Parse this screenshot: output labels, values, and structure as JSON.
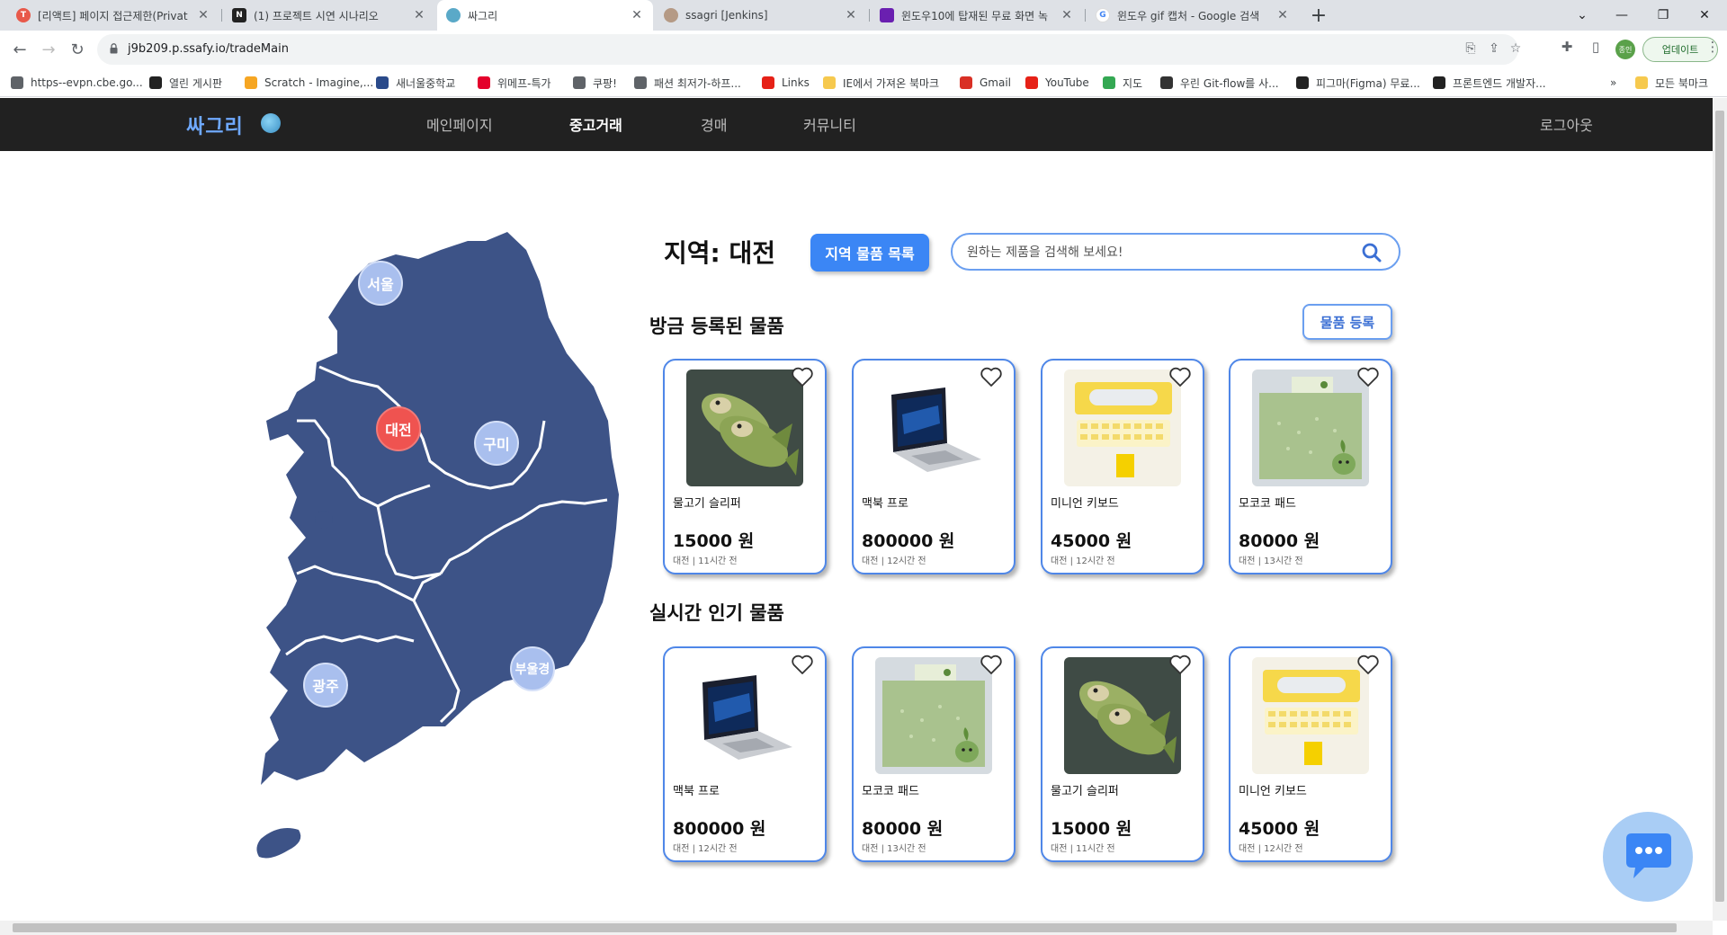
{
  "browser": {
    "tabs": [
      {
        "title": "[리액트] 페이지 접근제한(Privat",
        "favicon_color": "#e8594a",
        "favicon_text": "T"
      },
      {
        "title": "(1) 프로젝트 시연 시나리오",
        "favicon_color": "#222222",
        "favicon_text": "N"
      },
      {
        "title": "싸그리",
        "favicon_color": "#5aa9c8",
        "favicon_text": ""
      },
      {
        "title": "ssagri [Jenkins]",
        "favicon_color": "#b59a85",
        "favicon_text": ""
      },
      {
        "title": "윈도우10에 탑재된 무료 화면 녹",
        "favicon_color": "#6a1fb0",
        "favicon_text": ""
      },
      {
        "title": "윈도우 gif 캡처 - Google 검색",
        "favicon_color": "#ffffff",
        "favicon_text": "G"
      }
    ],
    "active_tab_index": 2,
    "url": "j9b209.p.ssafy.io/tradeMain",
    "profile_label": "종인",
    "update_label": "업데이트",
    "bookmarks": [
      {
        "label": "https--evpn.cbe.go...",
        "color": "#5f6368"
      },
      {
        "label": "열린 게시판",
        "color": "#222222"
      },
      {
        "label": "Scratch - Imagine,...",
        "color": "#f6a623"
      },
      {
        "label": "새너울중학교",
        "color": "#2a4a8a"
      },
      {
        "label": "위메프-특가",
        "color": "#e4002b"
      },
      {
        "label": "쿠팡!",
        "color": "#5f6368"
      },
      {
        "label": "패션 최저가-하프...",
        "color": "#5f6368"
      },
      {
        "label": "Links",
        "color": "#e62117"
      },
      {
        "label": "IE에서 가져온 북마크",
        "color": "#f6c94e"
      },
      {
        "label": "Gmail",
        "color": "#d93025"
      },
      {
        "label": "YouTube",
        "color": "#e62117"
      },
      {
        "label": "지도",
        "color": "#34a853"
      },
      {
        "label": "우린 Git-flow를 사...",
        "color": "#333333"
      },
      {
        "label": "피그마(Figma) 무료...",
        "color": "#222222"
      },
      {
        "label": "프론트엔드 개발자...",
        "color": "#222222"
      }
    ],
    "bookmarks_more": "»",
    "all_bookmarks": "모든 북마크"
  },
  "site": {
    "logo": "싸그리",
    "nav": [
      "메인페이지",
      "중고거래",
      "경매",
      "커뮤니티"
    ],
    "active_nav_index": 1,
    "logout": "로그아웃"
  },
  "map": {
    "fill_color": "#3d5387",
    "regions": [
      "서울",
      "대전",
      "구미",
      "광주",
      "부울경"
    ],
    "active_region": "대전"
  },
  "main": {
    "region_title": "지역: 대전",
    "region_list_button": "지역 물품 목록",
    "search_placeholder": "원하는 제품을 검색해 보세요!",
    "recent_title": "방금 등록된 물품",
    "register_button": "물품 등록",
    "popular_title": "실시간 인기 물품",
    "recent_items": [
      {
        "name": "물고기 슬리퍼",
        "price": "15000 원",
        "meta": "대전 | 11시간 전",
        "image": "fish"
      },
      {
        "name": "맥북 프로",
        "price": "800000 원",
        "meta": "대전 | 12시간 전",
        "image": "laptop"
      },
      {
        "name": "미니언 키보드",
        "price": "45000 원",
        "meta": "대전 | 12시간 전",
        "image": "keyboard"
      },
      {
        "name": "모코코 패드",
        "price": "80000 원",
        "meta": "대전 | 13시간 전",
        "image": "pad"
      }
    ],
    "popular_items": [
      {
        "name": "맥북 프로",
        "price": "800000 원",
        "meta": "대전 | 12시간 전",
        "image": "laptop"
      },
      {
        "name": "모코코 패드",
        "price": "80000 원",
        "meta": "대전 | 13시간 전",
        "image": "pad"
      },
      {
        "name": "물고기 슬리퍼",
        "price": "15000 원",
        "meta": "대전 | 11시간 전",
        "image": "fish"
      },
      {
        "name": "미니언 키보드",
        "price": "45000 원",
        "meta": "대전 | 12시간 전",
        "image": "keyboard"
      }
    ]
  },
  "colors": {
    "accent": "#3b86f5",
    "header_bg": "#212121",
    "card_border": "#4f87e8",
    "active_region": "#ef5350"
  }
}
